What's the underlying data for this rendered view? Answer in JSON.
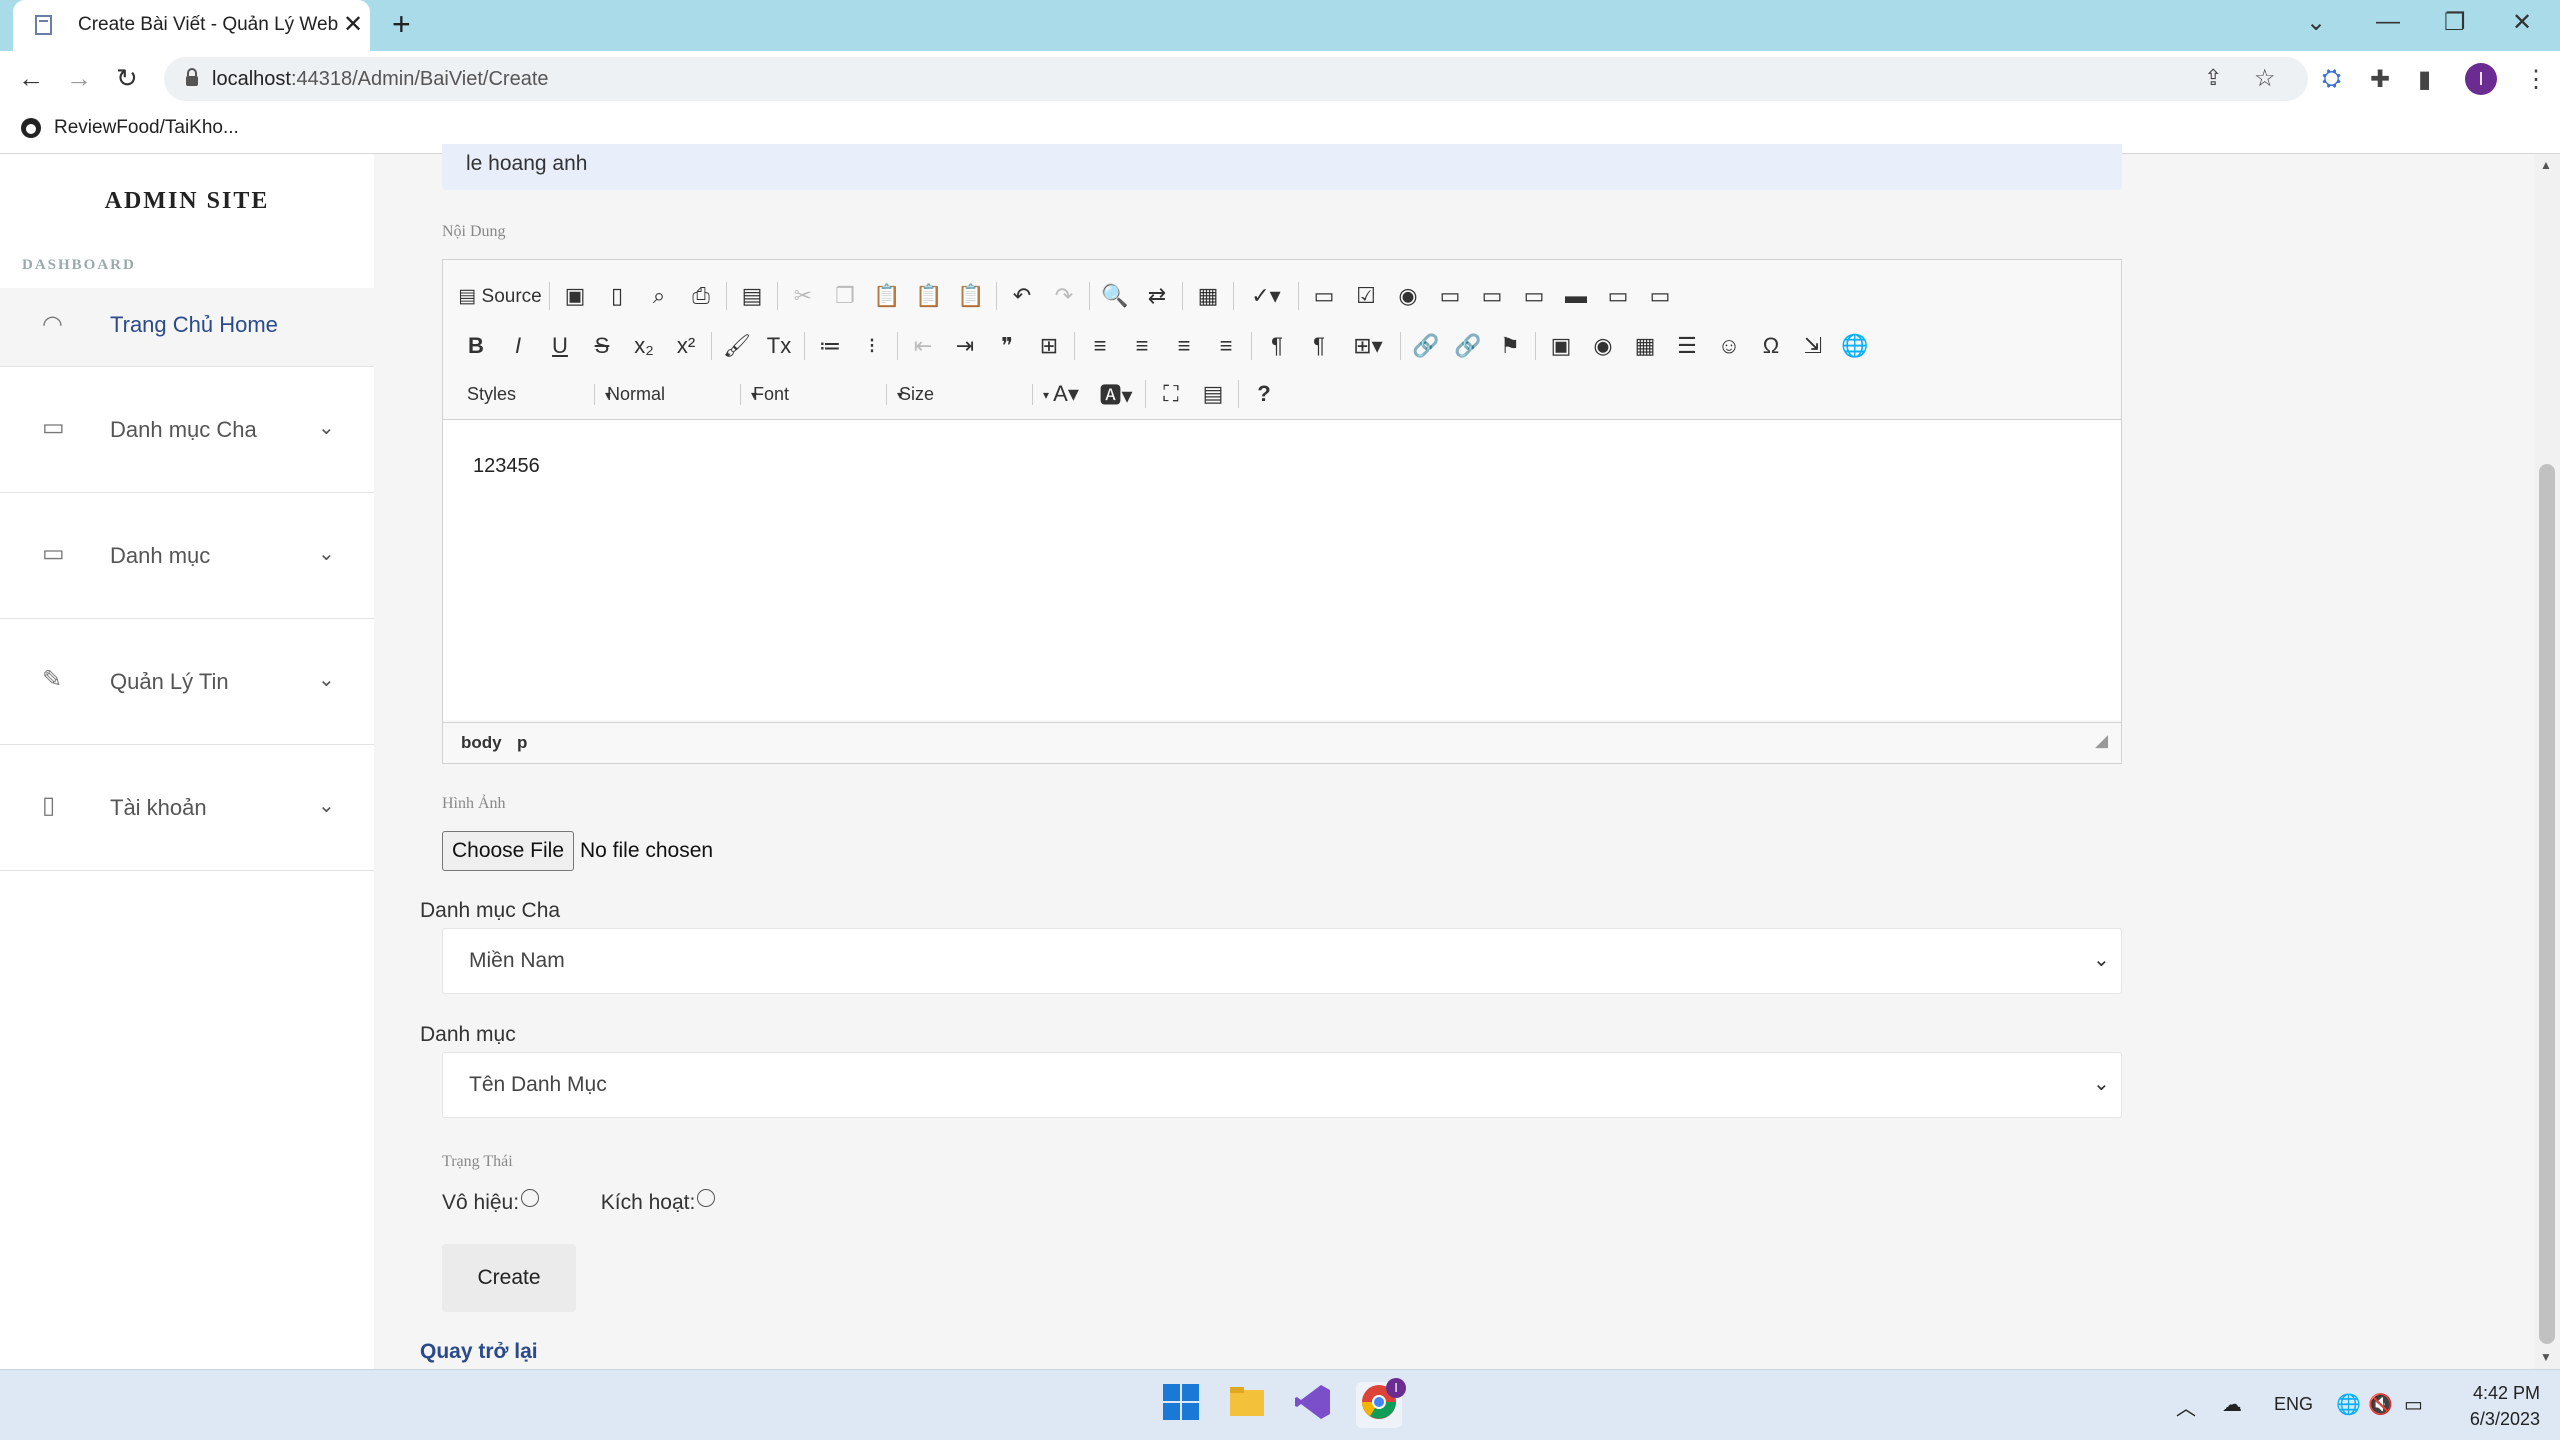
{
  "browser": {
    "tab_title": "Create Bài Viết - Quản Lý Web",
    "tab_close": "✕",
    "new_tab": "+",
    "url_host": "localhost",
    "url_path": ":44318/Admin/BaiViet/Create",
    "bookmark": "ReviewFood/TaiKho...",
    "avatar_letter": "I"
  },
  "sidebar": {
    "brand": "ADMIN SITE",
    "section": "DASHBOARD",
    "items": [
      {
        "label": "Trang Chủ Home"
      },
      {
        "label": "Danh mục Cha"
      },
      {
        "label": "Danh mục"
      },
      {
        "label": "Quản Lý Tin"
      },
      {
        "label": "Tài khoản"
      }
    ]
  },
  "form": {
    "prev_field_value": "le hoang anh",
    "content_label": "Nội Dung",
    "toolbar": {
      "source": "Source",
      "styles": "Styles",
      "format": "Normal",
      "font": "Font",
      "size": "Size",
      "help": "?"
    },
    "editor_text": "123456",
    "path_body": "body",
    "path_p": "p",
    "image_label": "Hình Ảnh",
    "choose_file": "Choose File",
    "no_file": "No file chosen",
    "parent_cat_label": "Danh mục Cha",
    "parent_cat_value": "Miền Nam",
    "cat_label": "Danh mục",
    "cat_value": "Tên Danh Mục",
    "status_label": "Trạng Thái",
    "disabled_label": "Vô hiệu:",
    "active_label": "Kích hoạt:",
    "create_button": "Create",
    "back_link": "Quay trở lại"
  },
  "taskbar": {
    "lang": "ENG",
    "time": "4:42 PM",
    "date": "6/3/2023",
    "chrome_badge": "I"
  },
  "colors": {
    "tabbar": "#a9dbe9",
    "accent_link": "#2a4a8a",
    "page_bg": "#f5f5f5"
  }
}
